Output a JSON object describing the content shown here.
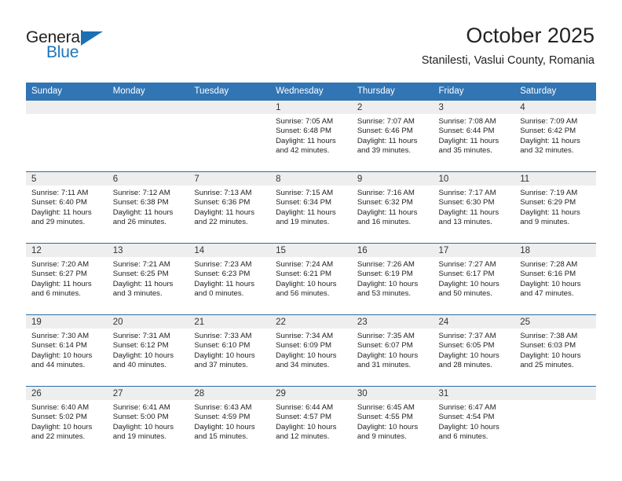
{
  "brand": {
    "name_top": "General",
    "name_bottom": "Blue",
    "triangle_icon": "triangle-icon",
    "accent_color": "#1c75bc"
  },
  "header": {
    "title": "October 2025",
    "subtitle": "Stanilesti, Vaslui County, Romania"
  },
  "theme": {
    "header_row_color": "#3175b4",
    "row_divider_color": "#2e6da4",
    "daynum_band_color": "#eeeeee"
  },
  "weekday_headers": [
    "Sunday",
    "Monday",
    "Tuesday",
    "Wednesday",
    "Thursday",
    "Friday",
    "Saturday"
  ],
  "labels": {
    "sunrise_prefix": "Sunrise:",
    "sunset_prefix": "Sunset:",
    "daylight_prefix": "Daylight:"
  },
  "weeks": [
    [
      {
        "day": "",
        "empty": true,
        "sunrise": "",
        "sunset": "",
        "daylight_line1": "",
        "daylight_line2": ""
      },
      {
        "day": "",
        "empty": true,
        "sunrise": "",
        "sunset": "",
        "daylight_line1": "",
        "daylight_line2": ""
      },
      {
        "day": "",
        "empty": true,
        "sunrise": "",
        "sunset": "",
        "daylight_line1": "",
        "daylight_line2": ""
      },
      {
        "day": "1",
        "empty": false,
        "sunrise": "Sunrise: 7:05 AM",
        "sunset": "Sunset: 6:48 PM",
        "daylight_line1": "Daylight: 11 hours",
        "daylight_line2": "and 42 minutes."
      },
      {
        "day": "2",
        "empty": false,
        "sunrise": "Sunrise: 7:07 AM",
        "sunset": "Sunset: 6:46 PM",
        "daylight_line1": "Daylight: 11 hours",
        "daylight_line2": "and 39 minutes."
      },
      {
        "day": "3",
        "empty": false,
        "sunrise": "Sunrise: 7:08 AM",
        "sunset": "Sunset: 6:44 PM",
        "daylight_line1": "Daylight: 11 hours",
        "daylight_line2": "and 35 minutes."
      },
      {
        "day": "4",
        "empty": false,
        "sunrise": "Sunrise: 7:09 AM",
        "sunset": "Sunset: 6:42 PM",
        "daylight_line1": "Daylight: 11 hours",
        "daylight_line2": "and 32 minutes."
      }
    ],
    [
      {
        "day": "5",
        "empty": false,
        "sunrise": "Sunrise: 7:11 AM",
        "sunset": "Sunset: 6:40 PM",
        "daylight_line1": "Daylight: 11 hours",
        "daylight_line2": "and 29 minutes."
      },
      {
        "day": "6",
        "empty": false,
        "sunrise": "Sunrise: 7:12 AM",
        "sunset": "Sunset: 6:38 PM",
        "daylight_line1": "Daylight: 11 hours",
        "daylight_line2": "and 26 minutes."
      },
      {
        "day": "7",
        "empty": false,
        "sunrise": "Sunrise: 7:13 AM",
        "sunset": "Sunset: 6:36 PM",
        "daylight_line1": "Daylight: 11 hours",
        "daylight_line2": "and 22 minutes."
      },
      {
        "day": "8",
        "empty": false,
        "sunrise": "Sunrise: 7:15 AM",
        "sunset": "Sunset: 6:34 PM",
        "daylight_line1": "Daylight: 11 hours",
        "daylight_line2": "and 19 minutes."
      },
      {
        "day": "9",
        "empty": false,
        "sunrise": "Sunrise: 7:16 AM",
        "sunset": "Sunset: 6:32 PM",
        "daylight_line1": "Daylight: 11 hours",
        "daylight_line2": "and 16 minutes."
      },
      {
        "day": "10",
        "empty": false,
        "sunrise": "Sunrise: 7:17 AM",
        "sunset": "Sunset: 6:30 PM",
        "daylight_line1": "Daylight: 11 hours",
        "daylight_line2": "and 13 minutes."
      },
      {
        "day": "11",
        "empty": false,
        "sunrise": "Sunrise: 7:19 AM",
        "sunset": "Sunset: 6:29 PM",
        "daylight_line1": "Daylight: 11 hours",
        "daylight_line2": "and 9 minutes."
      }
    ],
    [
      {
        "day": "12",
        "empty": false,
        "sunrise": "Sunrise: 7:20 AM",
        "sunset": "Sunset: 6:27 PM",
        "daylight_line1": "Daylight: 11 hours",
        "daylight_line2": "and 6 minutes."
      },
      {
        "day": "13",
        "empty": false,
        "sunrise": "Sunrise: 7:21 AM",
        "sunset": "Sunset: 6:25 PM",
        "daylight_line1": "Daylight: 11 hours",
        "daylight_line2": "and 3 minutes."
      },
      {
        "day": "14",
        "empty": false,
        "sunrise": "Sunrise: 7:23 AM",
        "sunset": "Sunset: 6:23 PM",
        "daylight_line1": "Daylight: 11 hours",
        "daylight_line2": "and 0 minutes."
      },
      {
        "day": "15",
        "empty": false,
        "sunrise": "Sunrise: 7:24 AM",
        "sunset": "Sunset: 6:21 PM",
        "daylight_line1": "Daylight: 10 hours",
        "daylight_line2": "and 56 minutes."
      },
      {
        "day": "16",
        "empty": false,
        "sunrise": "Sunrise: 7:26 AM",
        "sunset": "Sunset: 6:19 PM",
        "daylight_line1": "Daylight: 10 hours",
        "daylight_line2": "and 53 minutes."
      },
      {
        "day": "17",
        "empty": false,
        "sunrise": "Sunrise: 7:27 AM",
        "sunset": "Sunset: 6:17 PM",
        "daylight_line1": "Daylight: 10 hours",
        "daylight_line2": "and 50 minutes."
      },
      {
        "day": "18",
        "empty": false,
        "sunrise": "Sunrise: 7:28 AM",
        "sunset": "Sunset: 6:16 PM",
        "daylight_line1": "Daylight: 10 hours",
        "daylight_line2": "and 47 minutes."
      }
    ],
    [
      {
        "day": "19",
        "empty": false,
        "sunrise": "Sunrise: 7:30 AM",
        "sunset": "Sunset: 6:14 PM",
        "daylight_line1": "Daylight: 10 hours",
        "daylight_line2": "and 44 minutes."
      },
      {
        "day": "20",
        "empty": false,
        "sunrise": "Sunrise: 7:31 AM",
        "sunset": "Sunset: 6:12 PM",
        "daylight_line1": "Daylight: 10 hours",
        "daylight_line2": "and 40 minutes."
      },
      {
        "day": "21",
        "empty": false,
        "sunrise": "Sunrise: 7:33 AM",
        "sunset": "Sunset: 6:10 PM",
        "daylight_line1": "Daylight: 10 hours",
        "daylight_line2": "and 37 minutes."
      },
      {
        "day": "22",
        "empty": false,
        "sunrise": "Sunrise: 7:34 AM",
        "sunset": "Sunset: 6:09 PM",
        "daylight_line1": "Daylight: 10 hours",
        "daylight_line2": "and 34 minutes."
      },
      {
        "day": "23",
        "empty": false,
        "sunrise": "Sunrise: 7:35 AM",
        "sunset": "Sunset: 6:07 PM",
        "daylight_line1": "Daylight: 10 hours",
        "daylight_line2": "and 31 minutes."
      },
      {
        "day": "24",
        "empty": false,
        "sunrise": "Sunrise: 7:37 AM",
        "sunset": "Sunset: 6:05 PM",
        "daylight_line1": "Daylight: 10 hours",
        "daylight_line2": "and 28 minutes."
      },
      {
        "day": "25",
        "empty": false,
        "sunrise": "Sunrise: 7:38 AM",
        "sunset": "Sunset: 6:03 PM",
        "daylight_line1": "Daylight: 10 hours",
        "daylight_line2": "and 25 minutes."
      }
    ],
    [
      {
        "day": "26",
        "empty": false,
        "sunrise": "Sunrise: 6:40 AM",
        "sunset": "Sunset: 5:02 PM",
        "daylight_line1": "Daylight: 10 hours",
        "daylight_line2": "and 22 minutes."
      },
      {
        "day": "27",
        "empty": false,
        "sunrise": "Sunrise: 6:41 AM",
        "sunset": "Sunset: 5:00 PM",
        "daylight_line1": "Daylight: 10 hours",
        "daylight_line2": "and 19 minutes."
      },
      {
        "day": "28",
        "empty": false,
        "sunrise": "Sunrise: 6:43 AM",
        "sunset": "Sunset: 4:59 PM",
        "daylight_line1": "Daylight: 10 hours",
        "daylight_line2": "and 15 minutes."
      },
      {
        "day": "29",
        "empty": false,
        "sunrise": "Sunrise: 6:44 AM",
        "sunset": "Sunset: 4:57 PM",
        "daylight_line1": "Daylight: 10 hours",
        "daylight_line2": "and 12 minutes."
      },
      {
        "day": "30",
        "empty": false,
        "sunrise": "Sunrise: 6:45 AM",
        "sunset": "Sunset: 4:55 PM",
        "daylight_line1": "Daylight: 10 hours",
        "daylight_line2": "and 9 minutes."
      },
      {
        "day": "31",
        "empty": false,
        "sunrise": "Sunrise: 6:47 AM",
        "sunset": "Sunset: 4:54 PM",
        "daylight_line1": "Daylight: 10 hours",
        "daylight_line2": "and 6 minutes."
      },
      {
        "day": "",
        "empty": true,
        "sunrise": "",
        "sunset": "",
        "daylight_line1": "",
        "daylight_line2": ""
      }
    ]
  ]
}
